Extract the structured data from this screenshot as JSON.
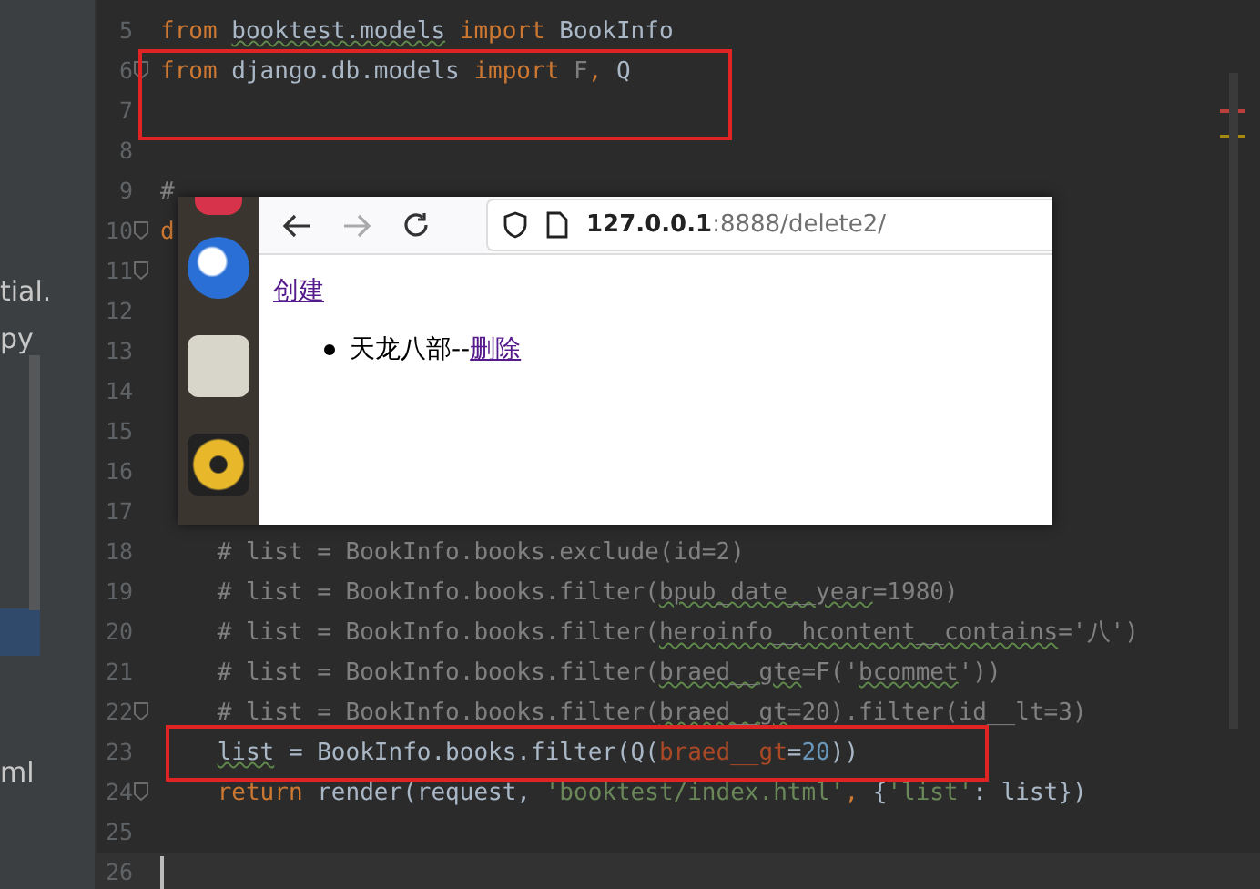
{
  "project_panel": {
    "items": [
      {
        "label": "tial."
      },
      {
        "label": "py"
      },
      {
        "label": "ml"
      }
    ]
  },
  "editor": {
    "lines": [
      {
        "number": "5",
        "fold": false,
        "current": false,
        "tokens": [
          {
            "text": "from ",
            "kind": "keyword"
          },
          {
            "text": "booktest.models",
            "squiggle": true
          },
          {
            "text": " import",
            "kind": "keyword"
          },
          {
            "text": " BookInfo"
          }
        ]
      },
      {
        "number": "6",
        "fold": true,
        "current": false,
        "tokens": [
          {
            "text": "from",
            "kind": "keyword"
          },
          {
            "text": " django.db.models "
          },
          {
            "text": "import",
            "kind": "keyword"
          },
          {
            "text": " F",
            "kind": "unused"
          },
          {
            "text": ",",
            "kind": "keyword"
          },
          {
            "text": " Q"
          }
        ]
      },
      {
        "number": "7",
        "fold": false,
        "current": false
      },
      {
        "number": "8",
        "fold": false,
        "current": false
      },
      {
        "number": "9",
        "fold": false,
        "current": false,
        "tokens": [
          {
            "text": "#",
            "kind": "comment"
          }
        ]
      },
      {
        "number": "10",
        "fold": true,
        "current": false,
        "tokens": [
          {
            "text": "d",
            "kind": "keyword"
          }
        ]
      },
      {
        "number": "11",
        "fold": true,
        "current": false
      },
      {
        "number": "12",
        "fold": false,
        "current": false
      },
      {
        "number": "13",
        "fold": false,
        "current": false
      },
      {
        "number": "14",
        "fold": false,
        "current": false
      },
      {
        "number": "15",
        "fold": false,
        "current": false
      },
      {
        "number": "16",
        "fold": false,
        "current": false
      },
      {
        "number": "17",
        "fold": false,
        "current": false
      },
      {
        "number": "18",
        "fold": false,
        "current": false,
        "tokens": [
          {
            "text": "    # list = BookInfo.books.exclude(id=2)",
            "kind": "comment"
          }
        ]
      },
      {
        "number": "19",
        "fold": false,
        "current": false,
        "tokens": [
          {
            "text": "    # list = BookInfo.books.filter(",
            "kind": "comment"
          },
          {
            "text": "bpub_date__year",
            "kind": "comment",
            "squiggle": true
          },
          {
            "text": "=1980)",
            "kind": "comment"
          }
        ]
      },
      {
        "number": "20",
        "fold": false,
        "current": false,
        "tokens": [
          {
            "text": "    # list = BookInfo.books.filter(",
            "kind": "comment"
          },
          {
            "text": "heroinfo__hcontent__contains",
            "kind": "comment",
            "squiggle": true
          },
          {
            "text": "='八')",
            "kind": "comment"
          }
        ]
      },
      {
        "number": "21",
        "fold": false,
        "current": false,
        "tokens": [
          {
            "text": "    # list = BookInfo.books.filter(",
            "kind": "comment"
          },
          {
            "text": "braed__gte",
            "kind": "comment",
            "squiggle": true
          },
          {
            "text": "=F('",
            "kind": "comment"
          },
          {
            "text": "bcommet",
            "kind": "comment",
            "squiggle": true
          },
          {
            "text": "'))",
            "kind": "comment"
          }
        ]
      },
      {
        "number": "22",
        "fold": true,
        "current": false,
        "tokens": [
          {
            "text": "    # list = BookInfo.books.filter(",
            "kind": "comment"
          },
          {
            "text": "braed__gt",
            "kind": "comment",
            "squiggle": true
          },
          {
            "text": "=20).filter(id__lt=3)",
            "kind": "comment"
          }
        ]
      },
      {
        "number": "23",
        "fold": false,
        "current": false,
        "tokens": [
          {
            "text": "    list",
            "squiggle": true
          },
          {
            "text": " = BookInfo.books.filter(Q("
          },
          {
            "text": "braed__gt",
            "kind": "param"
          },
          {
            "text": "="
          },
          {
            "text": "20",
            "kind": "number"
          },
          {
            "text": "))"
          }
        ]
      },
      {
        "number": "24",
        "fold": true,
        "current": false,
        "tokens": [
          {
            "text": "    return",
            "kind": "keyword"
          },
          {
            "text": " render(request, "
          },
          {
            "text": "'booktest/index.html'",
            "kind": "string"
          },
          {
            "text": ", ",
            "kind": "keyword"
          },
          {
            "text": "{"
          },
          {
            "text": "'list'",
            "kind": "string"
          },
          {
            "text": ": list})"
          }
        ]
      },
      {
        "number": "25",
        "fold": false,
        "current": false
      },
      {
        "number": "26",
        "fold": false,
        "current": true
      }
    ]
  },
  "browser": {
    "url_host": "127.0.0.1",
    "url_path": ":8888/delete2/",
    "create_link": "创建",
    "items": [
      {
        "text": "天龙八部--",
        "link": "删除"
      }
    ]
  }
}
